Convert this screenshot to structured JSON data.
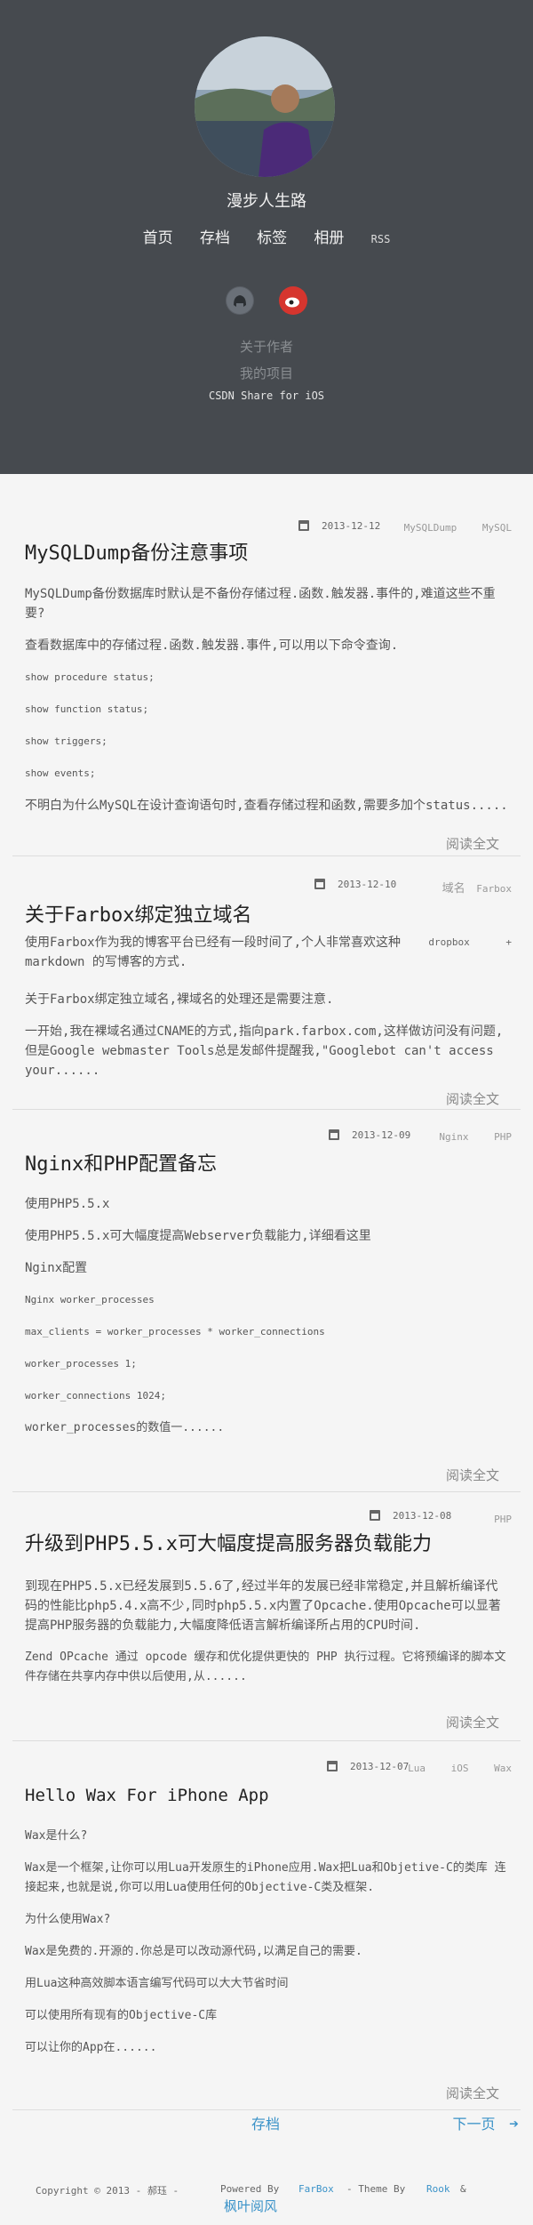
{
  "header": {
    "site_title": "漫步人生路",
    "nav": [
      "首页",
      "存档",
      "标签",
      "相册",
      "RSS"
    ],
    "links": [
      "关于作者",
      "我的项目"
    ],
    "csdn": "CSDN Share for iOS",
    "social_icons": [
      "github-icon",
      "weibo-icon"
    ]
  },
  "posts": [
    {
      "date": "2013-12-12",
      "tags": [
        "MySQLDump",
        "MySQL"
      ],
      "title": "MySQLDump备份注意事项",
      "paragraphs": [
        "MySQLDump备份数据库时默认是不备份存储过程.函数.触发器.事件的,难道这些不重要?",
        "查看数据库中的存储过程.函数.触发器.事件,可以用以下命令查询.",
        "show procedure status;",
        "show function status;",
        "show triggers;",
        "show events;",
        "不明白为什么MySQL在设计查询语句时,查看存储过程和函数,需要多加个status......"
      ],
      "readmore": "阅读全文"
    },
    {
      "date": "2013-12-10",
      "tags": [
        "域名",
        "Farbox",
        "dropbox",
        "+"
      ],
      "title": "关于Farbox绑定独立域名",
      "paragraphs": [
        "使用Farbox作为我的博客平台已经有一段时间了,个人非常喜欢这种 markdown 的写博客的方式.",
        "关于Farbox绑定独立域名,裸域名的处理还是需要注意.",
        "一开始,我在裸域名通过CNAME的方式,指向park.farbox.com,这样做访问没有问题,但是Google webmaster Tools总是发邮件提醒我,\"Googlebot can't access your......"
      ],
      "readmore": "阅读全文"
    },
    {
      "date": "2013-12-09",
      "tags": [
        "Nginx",
        "PHP"
      ],
      "title": "Nginx和PHP配置备忘",
      "paragraphs": [
        "使用PHP5.5.x",
        "使用PHP5.5.x可大幅度提高Webserver负载能力,详细看这里",
        "Nginx配置",
        "Nginx worker_processes",
        "max_clients = worker_processes * worker_connections",
        "worker_processes 1;",
        "worker_connections 1024;",
        "worker_processes的数值一......"
      ],
      "readmore": "阅读全文"
    },
    {
      "date": "2013-12-08",
      "tags": [
        "PHP"
      ],
      "title": "升级到PHP5.5.x可大幅度提高服务器负载能力",
      "paragraphs": [
        "到现在PHP5.5.x已经发展到5.5.6了,经过半年的发展已经非常稳定,并且解析编译代码的性能比php5.4.x高不少,同时php5.5.x内置了Opcache.使用Opcache可以显著提高PHP服务器的负载能力,大幅度降低语言解析编译所占用的CPU时间.",
        "Zend OPcache 通过 opcode 缓存和优化提供更快的 PHP 执行过程。它将预编译的脚本文件存储在共享内存中供以后使用,从......"
      ],
      "readmore": "阅读全文"
    },
    {
      "date": "2013-12-07",
      "tags": [
        "Lua",
        "iOS",
        "Wax"
      ],
      "title": "Hello Wax For iPhone App",
      "paragraphs": [
        "Wax是什么?",
        "Wax是一个框架,让你可以用Lua开发原生的iPhone应用.Wax把Lua和Objetive-C的类库 连接起来,也就是说,你可以用Lua使用任何的Objective-C类及框架.",
        "为什么使用Wax?",
        "Wax是免费的.开源的.你总是可以改动源代码,以满足自己的需要.",
        "用Lua这种高效脚本语言编写代码可以大大节省时间",
        "可以使用所有现有的Objective-C库",
        "可以让你的App在......"
      ],
      "readmore": "阅读全文"
    }
  ],
  "pager": {
    "archive": "存档",
    "next": "下一页"
  },
  "footer": {
    "copyright": "Copyright © 2013 - 郝珏 -",
    "powered": "Powered By",
    "farbox": "FarBox",
    "theme": "- Theme By",
    "rook": "Rook",
    "amp": "&",
    "fengye": "枫叶阅风"
  },
  "colors": {
    "header_bg": "#464a4f",
    "link_blue": "#3a92c8",
    "weibo_red": "#d6352e"
  }
}
